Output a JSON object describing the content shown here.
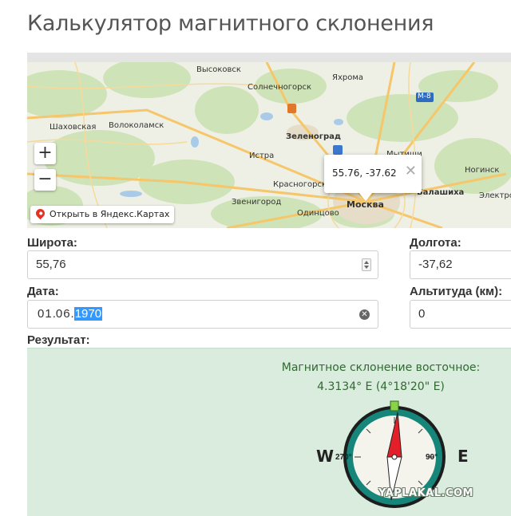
{
  "page": {
    "title": "Калькулятор магнитного склонения"
  },
  "map": {
    "labels": {
      "vysokovsk": "Высоковск",
      "solnechnogorsk": "Солнечногорск",
      "yakhroma": "Яхрома",
      "shakhovskaya": "Шаховская",
      "volokolamsk": "Волоколамск",
      "zelenograd": "Зеленоград",
      "istra": "Истра",
      "mytishchi": "Мытищи",
      "krasnogorsk": "Красногорск",
      "noginsk": "Ногинск",
      "zvenigorod": "Звенигород",
      "odintsovo": "Одинцово",
      "moskva": "Москва",
      "balashikha": "Балашиха",
      "elektrostal": "Электросталь",
      "road_m8": "М-8"
    },
    "zoom_in": "+",
    "zoom_out": "−",
    "open_yandex": "Открыть в Яндекс.Картах",
    "balloon_coords": "55.76, -37.62",
    "balloon_close": "✕"
  },
  "form": {
    "latitude_label": "Широта:",
    "latitude_value": "55,76",
    "longitude_label": "Долгота:",
    "longitude_value": "-37,62",
    "date_label": "Дата:",
    "date_day": "01",
    "date_month": "06",
    "date_year": "1970",
    "date_sep": ".",
    "altitude_label": "Альтитуда (км):",
    "altitude_value": "0",
    "clear_icon": "✕"
  },
  "result": {
    "label": "Результат:",
    "declination_title": "Магнитное склонение восточное:",
    "declination_value": "4.3134° E (4°18'20\" E)",
    "compass_w": "W",
    "compass_e": "E",
    "compass_270": "270°",
    "compass_90": "90°"
  },
  "watermark": "YAPLAKAL.COM",
  "colors": {
    "result_bg": "#d9ecdd",
    "result_text": "#2f6b2f",
    "compass_ring": "#17867a",
    "needle_red": "#e3202a",
    "selection": "#3399ff"
  }
}
